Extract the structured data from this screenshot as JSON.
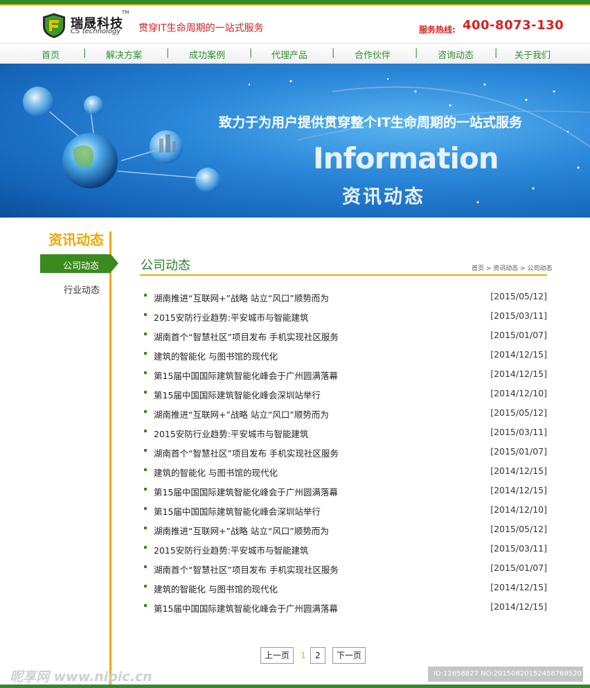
{
  "header": {
    "logo_cn": "瑞晟科技",
    "logo_tm": "TM",
    "logo_en": "CS technology",
    "slogan": "贯穿IT生命周期的一站式服务",
    "hotline_label": "服务热线:",
    "hotline_number": "400-8073-130"
  },
  "nav": {
    "items": [
      "首页",
      "解决方案",
      "成功案例",
      "代理产品",
      "合作伙伴",
      "咨询动态",
      "关于我们"
    ],
    "separator": "|"
  },
  "banner": {
    "title": "致力于为用户提供贯穿整个IT生命周期的一站式服务",
    "english": "Information",
    "chinese": "资讯动态"
  },
  "sidebar": {
    "title": "资讯动态",
    "items": [
      {
        "label": "公司动态",
        "active": true
      },
      {
        "label": "行业动态",
        "active": false
      }
    ]
  },
  "main": {
    "title": "公司动态",
    "breadcrumb": "首页 > 资讯动态 > 公司动态",
    "news": [
      {
        "title": "湖南推进“互联网+”战略  站立“风口”顺势而为",
        "date": "[2015/05/12]"
      },
      {
        "title": "2015安防行业趋势:平安城市与智能建筑",
        "date": "[2015/03/11]"
      },
      {
        "title": "湖南首个“智慧社区”项目发布  手机实现社区服务",
        "date": "[2015/01/07]"
      },
      {
        "title": "建筑的智能化  与图书馆的现代化",
        "date": "[2014/12/15]"
      },
      {
        "title": "第15届中国国际建筑智能化峰会于广州圆满落幕",
        "date": "[2014/12/15]"
      },
      {
        "title": "第15届中国国际建筑智能化峰会深圳站举行",
        "date": "[2014/12/10]"
      },
      {
        "title": "湖南推进“互联网+”战略  站立“风口”顺势而为",
        "date": "[2015/05/12]"
      },
      {
        "title": "2015安防行业趋势:平安城市与智能建筑",
        "date": "[2015/03/11]"
      },
      {
        "title": "湖南首个“智慧社区”项目发布  手机实现社区服务",
        "date": "[2015/01/07]"
      },
      {
        "title": "建筑的智能化  与图书馆的现代化",
        "date": "[2014/12/15]"
      },
      {
        "title": "第15届中国国际建筑智能化峰会于广州圆满落幕",
        "date": "[2014/12/15]"
      },
      {
        "title": "第15届中国国际建筑智能化峰会深圳站举行",
        "date": "[2014/12/10]"
      },
      {
        "title": "湖南推进“互联网+”战略  站立“风口”顺势而为",
        "date": "[2015/05/12]"
      },
      {
        "title": "2015安防行业趋势:平安城市与智能建筑",
        "date": "[2015/03/11]"
      },
      {
        "title": "湖南首个“智慧社区”项目发布  手机实现社区服务",
        "date": "[2015/01/07]"
      },
      {
        "title": "建筑的智能化  与图书馆的现代化",
        "date": "[2014/12/15]"
      },
      {
        "title": "第15届中国国际建筑智能化峰会于广州圆满落幕",
        "date": "[2014/12/15]"
      }
    ]
  },
  "pager": {
    "prev": "上一页",
    "current": "1",
    "page2": "2",
    "next": "下一页"
  },
  "watermark": {
    "left": "昵享网 www.nipic.cn",
    "right": "ID:12658827 NO:20150820152458769520"
  },
  "colors": {
    "brand_green": "#2e8b2e",
    "accent_orange": "#f0a800",
    "hotline_red": "#d42020",
    "banner_blue": "#2a86d8"
  }
}
